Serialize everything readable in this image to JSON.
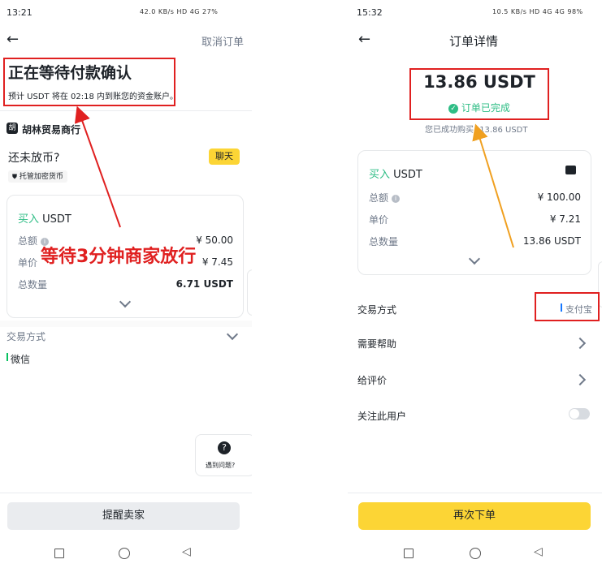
{
  "left": {
    "status_time": "13:21",
    "status_icons": "42.0 KB/s  HD  4G  27%",
    "cancel_order": "取消订单",
    "heading": "正在等待付款确认",
    "subtext": "预计 USDT 将在 02:18 内到账您的资金账户。",
    "merchant_badge": "胡",
    "merchant_name": "胡林贸易商行",
    "not_released": "还未放币?",
    "chat_button": "聊天",
    "escrow_label": "托管加密货币",
    "buy_label": "买入",
    "asset": "USDT",
    "rows": [
      {
        "label": "总额",
        "value": "¥ 50.00"
      },
      {
        "label": "单价",
        "value": "¥ 7.45"
      },
      {
        "label": "总数量",
        "value": "6.71 USDT"
      }
    ],
    "annotation": "等待3分钟商家放行",
    "payment_label": "交易方式",
    "payment_method": "微信",
    "help_label": "遇到问题?",
    "remind_button": "提醒卖家"
  },
  "right": {
    "status_time": "15:32",
    "status_icons": "10.5 KB/s  HD  4G  4G  98%",
    "title": "订单详情",
    "amount": "13.86 USDT",
    "completed": "订单已完成",
    "success_text": "您已成功购买",
    "success_amount": "13.86 USDT",
    "buy_label": "买入",
    "asset": "USDT",
    "rows": [
      {
        "label": "总额",
        "value": "¥ 100.00"
      },
      {
        "label": "单价",
        "value": "¥ 7.21"
      },
      {
        "label": "总数量",
        "value": "13.86 USDT"
      }
    ],
    "payment_label": "交易方式",
    "payment_method": "支付宝",
    "need_help": "需要帮助",
    "rate": "给评价",
    "follow": "关注此用户",
    "reorder_button": "再次下单"
  },
  "colors": {
    "green": "#2ebd85",
    "yellow": "#fcd535",
    "red_annotation": "#e02020",
    "orange_arrow": "#f0a020",
    "wechat_green": "#07c160",
    "alipay_blue": "#1677ff"
  }
}
